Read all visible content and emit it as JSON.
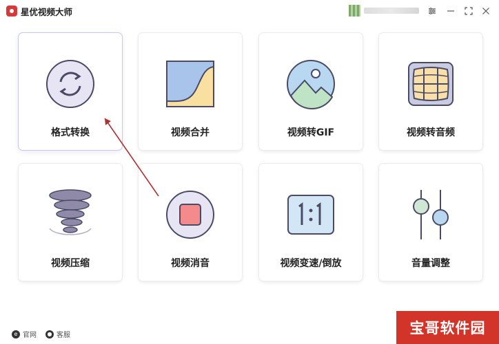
{
  "app": {
    "title": "星优视频大师"
  },
  "window_controls": [
    "settings-icon",
    "minimize-icon",
    "maximize-icon",
    "close-icon"
  ],
  "tools": [
    {
      "label": "格式转换",
      "icon": "convert-refresh-icon"
    },
    {
      "label": "视频合并",
      "icon": "merge-curve-icon"
    },
    {
      "label": "视频转GIF",
      "icon": "image-gif-icon"
    },
    {
      "label": "视频转音频",
      "icon": "audio-film-icon"
    },
    {
      "label": "视频压缩",
      "icon": "tornado-compress-icon"
    },
    {
      "label": "视频消音",
      "icon": "mute-square-icon"
    },
    {
      "label": "视频变速/倒放",
      "icon": "ratio-speed-icon"
    },
    {
      "label": "音量调整",
      "icon": "slider-volume-icon"
    }
  ],
  "footer": {
    "website": "官网",
    "support": "客服"
  },
  "watermark": {
    "text": "宝哥软件园"
  },
  "colors": {
    "accent": "#6b6bc8",
    "watermark_bg": "#d3342a"
  }
}
